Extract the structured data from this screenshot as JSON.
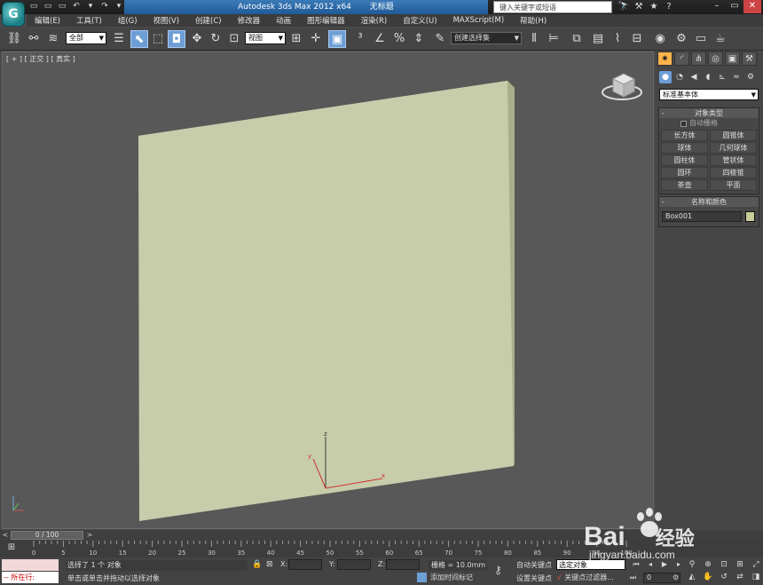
{
  "app": {
    "logo_letter": "G",
    "title_parts": [
      "Autodesk 3ds Max  2012 x64",
      "无标题"
    ],
    "search_placeholder": "键入关键字或短语",
    "quick_access": [
      "▭",
      "▭",
      "▭",
      "↶",
      "▾",
      "↷",
      "▾",
      "▾"
    ],
    "title_icons": [
      "🔭",
      "⚒",
      "★",
      "?"
    ],
    "window_controls": [
      "–",
      "▭",
      "✕"
    ]
  },
  "menu": {
    "items": [
      "编辑(E)",
      "工具(T)",
      "组(G)",
      "视图(V)",
      "创建(C)",
      "修改器",
      "动画",
      "图形编辑器",
      "渲染(R)",
      "自定义(U)",
      "MAXScript(M)",
      "帮助(H)"
    ]
  },
  "toolbar": {
    "selection_filter": "全部",
    "ref_coord": "视图",
    "named_selection": "创建选择集"
  },
  "viewport": {
    "label": "[ + ] [ 正交 ] [ 真实 ]",
    "object_color": "#c7ccaa",
    "axis_labels": {
      "x": "x",
      "y": "y",
      "z": "z"
    },
    "background": "#585858"
  },
  "command_panel": {
    "primitive_type": "标准基本体",
    "object_type_title": "对象类型",
    "autogrid_label": "自动栅格",
    "object_buttons": [
      "长方体",
      "圆锥体",
      "球体",
      "几何球体",
      "圆柱体",
      "管状体",
      "圆环",
      "四棱锥",
      "茶壶",
      "平面"
    ],
    "name_color_title": "名称和颜色",
    "object_name": "Box001",
    "object_color": "#c8cc9a"
  },
  "timeline": {
    "current_frame": "0 / 100",
    "ticks": [
      "0",
      "5",
      "10",
      "15",
      "20",
      "25",
      "30",
      "35",
      "40",
      "45",
      "50",
      "55",
      "60",
      "65",
      "70",
      "75",
      "80",
      "85",
      "90",
      "95",
      "100"
    ]
  },
  "status": {
    "listener_label": "所在行:",
    "selection_msg": "选择了 1 个 对象",
    "prompt_msg": "单击或单击并拖动以选择对象",
    "x_label": "X:",
    "y_label": "Y:",
    "z_label": "Z:",
    "grid_info": "栅格 = 10.0mm",
    "add_time_tag": "添加时间标记",
    "auto_key": "自动关键点",
    "set_key": "设置关键点",
    "selection_set": "选定对象",
    "key_filters": "关键点过滤器...",
    "frame_value": "0"
  },
  "watermark": {
    "logo": "Bai",
    "logo_suffix": "经验",
    "url": "jingyan.baidu.com"
  }
}
